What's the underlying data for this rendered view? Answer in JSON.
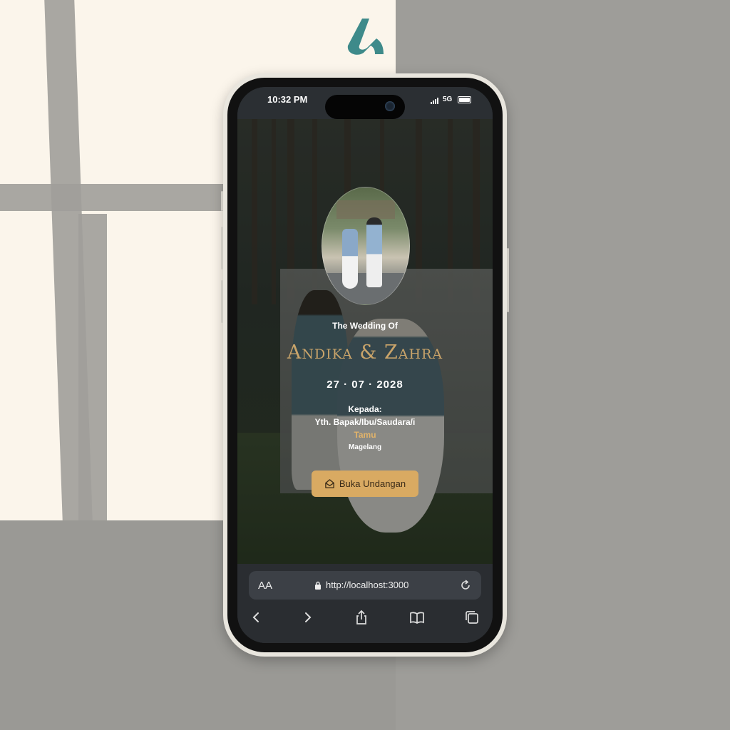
{
  "status_bar": {
    "time": "10:32 PM",
    "network": "5G"
  },
  "invitation": {
    "subtitle": "The Wedding Of",
    "couple_names": "Andika & Zahra",
    "date": "27 · 07 · 2028",
    "to_label": "Kepada:",
    "to_line": "Yth. Bapak/Ibu/Saudara/i",
    "guest_name": "Tamu",
    "guest_city": "Magelang",
    "open_button_label": "Buka Undangan"
  },
  "browser": {
    "text_size_label": "AA",
    "url": "http://localhost:3000"
  },
  "colors": {
    "accent_gold": "#d9aa62",
    "names_gold": "#c9a46a",
    "logo_teal": "#3e8a8a"
  },
  "icons": [
    "brand-logo-icon",
    "lock-icon",
    "reload-icon",
    "back-icon",
    "forward-icon",
    "share-icon",
    "bookmarks-icon",
    "tabs-icon",
    "envelope-icon"
  ]
}
